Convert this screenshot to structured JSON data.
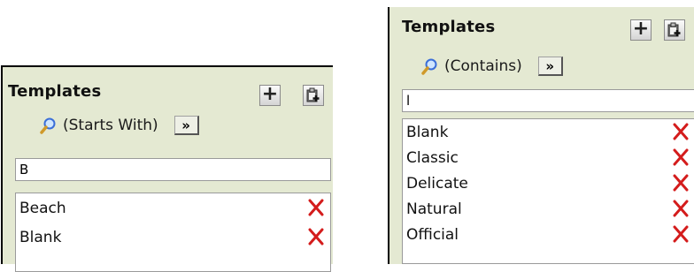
{
  "left": {
    "title": "Templates",
    "filter_mode": "(Starts With)",
    "more_label": "»",
    "search_value": "B",
    "items": [
      "Beach",
      "Blank"
    ]
  },
  "right": {
    "title": "Templates",
    "filter_mode": "(Contains)",
    "more_label": "»",
    "search_value": "l",
    "items": [
      "Blank",
      "Classic",
      "Delicate",
      "Natural",
      "Official"
    ]
  },
  "colors": {
    "panel_bg": "#e4e9d2",
    "delete_red": "#d41c1c"
  },
  "icons": {
    "add": "plus-icon",
    "paste": "clipboard-add-icon",
    "search": "magnifier-icon",
    "delete": "delete-x-icon"
  }
}
